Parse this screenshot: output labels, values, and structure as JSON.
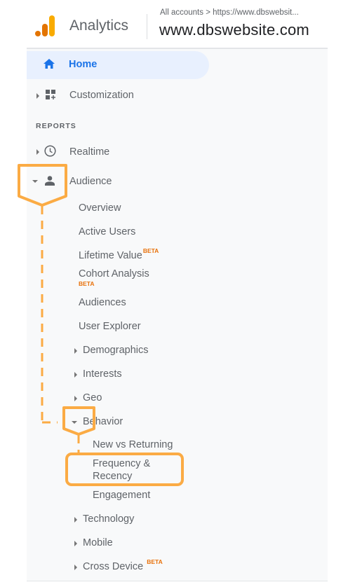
{
  "header": {
    "app_name": "Analytics",
    "breadcrumb": "All accounts > https://www.dbswebsit...",
    "property_name": "www.dbswebsite.com",
    "logo_colors": [
      "#e37400",
      "#f9ab00"
    ]
  },
  "nav": {
    "home": {
      "label": "Home",
      "icon": "home-icon",
      "active": true
    },
    "customization": {
      "label": "Customization",
      "icon": "dashboard-plus-icon"
    },
    "section_label": "REPORTS",
    "realtime": {
      "label": "Realtime",
      "icon": "clock-icon"
    },
    "audience": {
      "label": "Audience",
      "icon": "person-icon",
      "expanded": true,
      "children": [
        {
          "label": "Overview"
        },
        {
          "label": "Active Users"
        },
        {
          "label": "Lifetime Value",
          "badge": "BETA"
        },
        {
          "label": "Cohort Analysis",
          "badge": "BETA"
        },
        {
          "label": "Audiences"
        },
        {
          "label": "User Explorer"
        },
        {
          "label": "Demographics",
          "expandable": true
        },
        {
          "label": "Interests",
          "expandable": true
        },
        {
          "label": "Geo",
          "expandable": true
        },
        {
          "label": "Behavior",
          "expandable": true,
          "expanded": true
        },
        {
          "label": "Technology",
          "expandable": true
        },
        {
          "label": "Mobile",
          "expandable": true
        },
        {
          "label": "Cross Device",
          "expandable": true,
          "badge": "BETA"
        }
      ],
      "behavior_children": [
        {
          "label": "New vs Returning"
        },
        {
          "label": "Frequency &\nRecency",
          "line1": "Frequency &",
          "line2": "Recency",
          "highlighted": true
        },
        {
          "label": "Engagement"
        }
      ]
    }
  },
  "colors": {
    "accent_blue": "#1a73e8",
    "active_bg": "#e8f0fe",
    "beta": "#e8710a",
    "annotation": "#fbab44",
    "panel_bg": "#f8f9fa"
  }
}
